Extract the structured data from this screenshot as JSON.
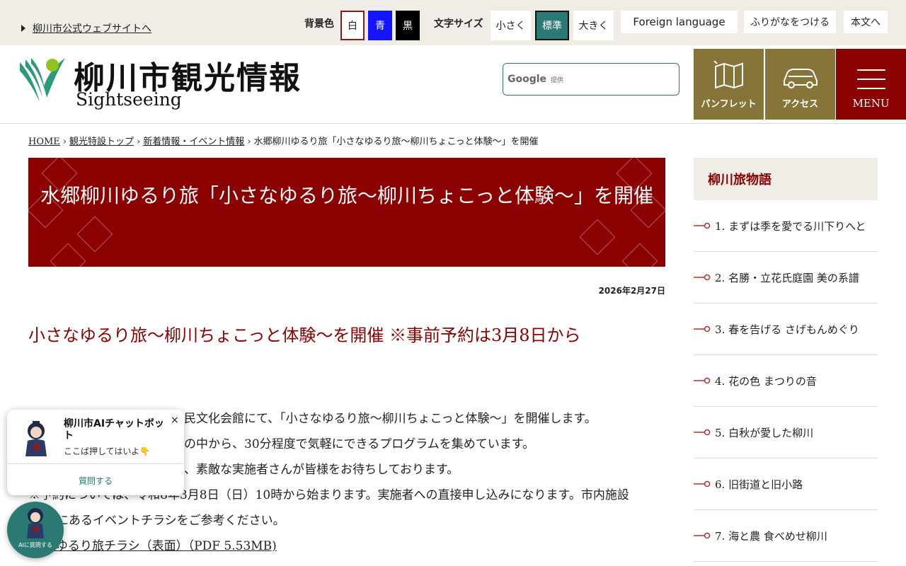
{
  "topbar": {
    "city_link": "柳川市公式ウェブサイトへ",
    "bg_label": "背景色",
    "bg_white": "白",
    "bg_blue": "青",
    "bg_black": "黒",
    "fontsize_label": "文字サイズ",
    "fs_small": "小さく",
    "fs_standard": "標準",
    "fs_large": "大きく",
    "foreign": "Foreign language",
    "furigana": "ふりがなをつける",
    "to_body": "本文へ"
  },
  "header": {
    "title": "柳川市観光情報",
    "subtitle": "Sightseeing",
    "search_brand": "Google",
    "search_provided": "提供",
    "nav": {
      "pamphlet": "パンフレット",
      "access": "アクセス",
      "menu": "MENU"
    }
  },
  "breadcrumb": {
    "home": "HOME",
    "top": "観光特設トップ",
    "news": "新着情報・イベント情報",
    "current": "水郷柳川ゆるり旅「小さなゆるり旅～柳川ちょこっと体験～」を開催",
    "sep": "›"
  },
  "article": {
    "title": "水郷柳川ゆるり旅「小さなゆるり旅～柳川ちょこっと体験～」を開催",
    "date": "2026年2月27日",
    "subheading": "小さなゆるり旅～柳川ちょこっと体験～を開催 ※事前予約は3月8日から",
    "lines": [
      "民文化会館にて、「小さなゆるり旅～柳川ちょこっと体験～」を開催します。",
      "の中から、30分程度で気軽にできるプログラムを集めています。",
      "、素敵な実施者さんが皆様をお待ちしております。",
      "※予約については、令和8年3月8日（日）10時から始まります。実施者への直接申し込みになります。市内施設",
      "にあるイベントチラシをご参考ください。"
    ],
    "link": "なゆるり旅チラシ（表面）（PDF 5.53MB)"
  },
  "sidebar": {
    "heading": "柳川旅物語",
    "items": [
      "1. まずは季を愛でる川下りへと",
      "2. 名勝・立花氏庭園 美の系譜",
      "3. 春を告げる さげもんめぐり",
      "4. 花の色 まつりの音",
      "5. 白秋が愛した柳川",
      "6. 旧街道と旧小路",
      "7. 海と農 食べめせ柳川"
    ]
  },
  "chatbot": {
    "title": "柳川市AIチャットボット",
    "subtitle": "ここば押してはいよ👇",
    "close": "×",
    "ask": "質問する",
    "fab_label": "AIに質問する"
  },
  "colors": {
    "accent_red": "#8b0000",
    "accent_gold": "#867438",
    "accent_teal": "#2a7a73",
    "topbar_bg": "#efede6"
  }
}
